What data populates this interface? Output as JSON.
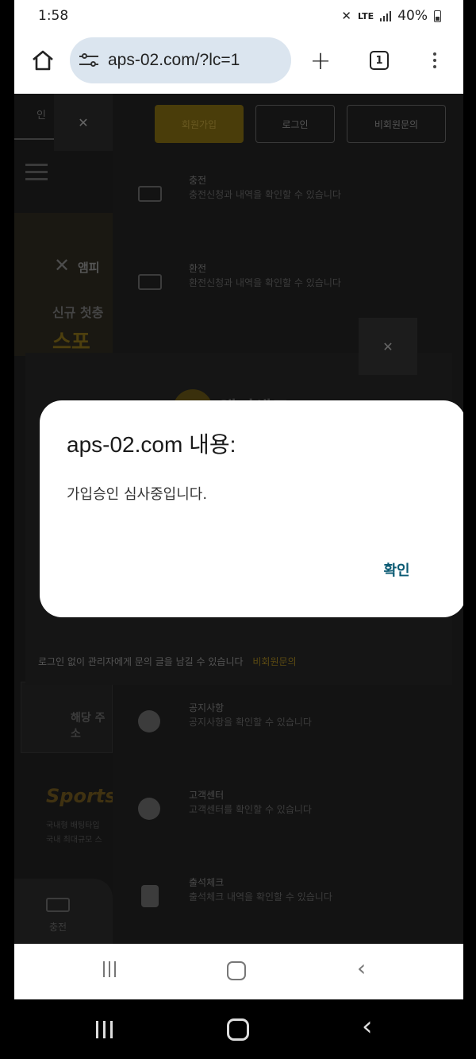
{
  "status_bar": {
    "time": "1:58",
    "network": "LTE",
    "battery": "40%"
  },
  "browser": {
    "url": "aps-02.com/?lc=1",
    "tab_count": "1"
  },
  "page_bg": {
    "top_tab_fragment": "인",
    "banner_logo": "앰피",
    "banner_text": "신규 첫충",
    "banner_yellow": "스포",
    "notice_card_text": "해당 주소",
    "sports_logo": "Sports",
    "sports_line1": "국내형 배팅타입",
    "sports_line2": "국내 최대규모 스",
    "fab_label": "충전"
  },
  "drawer": {
    "join": "회원가입",
    "login": "로그인",
    "inquiry": "비회원문의",
    "items": [
      {
        "title": "충전",
        "desc": "충전신청과 내역을 확인할 수 있습니다"
      },
      {
        "title": "환전",
        "desc": "환전신청과 내역을 확인할 수 있습니다"
      },
      {
        "title": "공지사항",
        "desc": "공지사항을 확인할 수 있습니다"
      },
      {
        "title": "고객센터",
        "desc": "고객센터를 확인할 수 있습니다"
      },
      {
        "title": "출석체크",
        "desc": "출석체크 내역을 확인할 수 있습니다"
      }
    ]
  },
  "modal2": {
    "brand": "앰피샌드",
    "bottom_text": "로그인 없이 관리자에게 문의 글을 남길 수 있습니다",
    "bottom_link": "비회원문의"
  },
  "dialog": {
    "title": "aps-02.com 내용:",
    "message": "가입승인 심사중입니다.",
    "ok": "확인"
  }
}
